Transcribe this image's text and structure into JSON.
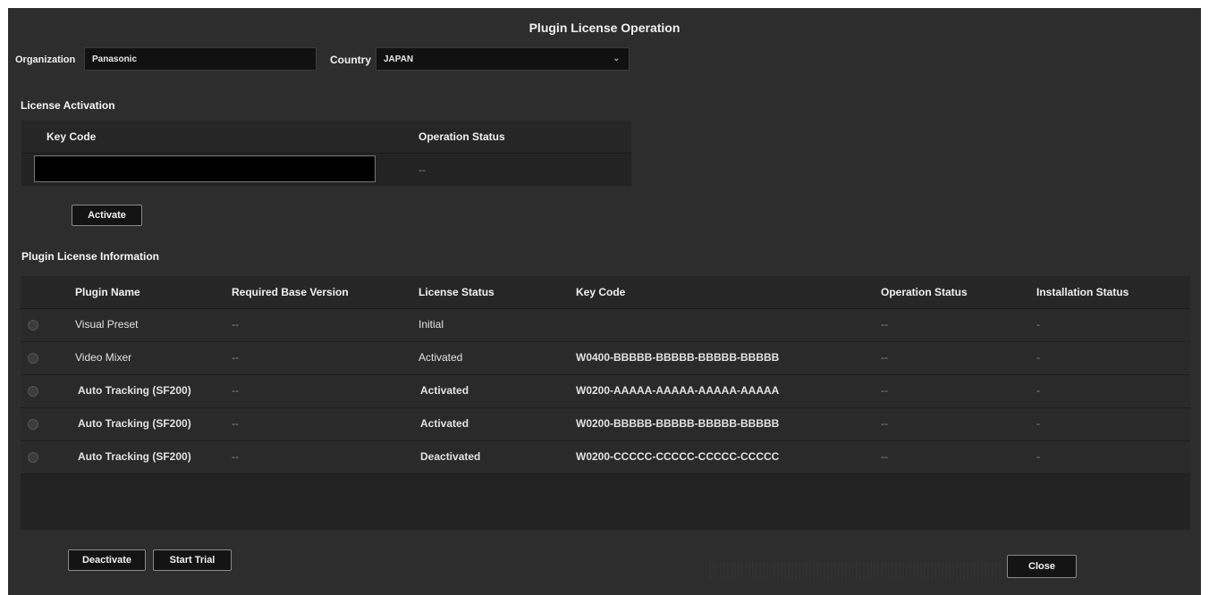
{
  "window": {
    "title": "Plugin License Operation"
  },
  "organization": {
    "label": "Organization",
    "value": "Panasonic"
  },
  "country": {
    "label": "Country",
    "value": "JAPAN"
  },
  "activation": {
    "section_title": "License Activation",
    "col_key_code": "Key Code",
    "col_operation_status": "Operation Status",
    "key_value": "",
    "operation_status": "--",
    "activate_label": "Activate"
  },
  "info": {
    "section_title": "Plugin License Information",
    "columns": {
      "plugin_name": "Plugin Name",
      "required_base_version": "Required Base Version",
      "license_status": "License Status",
      "key_code": "Key Code",
      "operation_status": "Operation Status",
      "installation_status": "Installation Status"
    },
    "rows": [
      {
        "plugin_name": "Visual Preset",
        "base_version": "--",
        "license_status": "Initial",
        "key_code": "",
        "operation_status": "--",
        "installation_status": "-"
      },
      {
        "plugin_name": "Video Mixer",
        "base_version": "--",
        "license_status": "Activated",
        "key_code": "W0400-BBBBB-BBBBB-BBBBB-BBBBB",
        "operation_status": "--",
        "installation_status": "-"
      },
      {
        "plugin_name": "Auto Tracking (SF200)",
        "base_version": "--",
        "license_status": "Activated",
        "key_code": "W0200-AAAAA-AAAAA-AAAAA-AAAAA",
        "operation_status": "--",
        "installation_status": "-"
      },
      {
        "plugin_name": "Auto Tracking (SF200)",
        "base_version": "--",
        "license_status": "Activated",
        "key_code": "W0200-BBBBB-BBBBB-BBBBB-BBBBB",
        "operation_status": "--",
        "installation_status": "-"
      },
      {
        "plugin_name": "Auto Tracking (SF200)",
        "base_version": "--",
        "license_status": "Deactivated",
        "key_code": "W0200-CCCCC-CCCCC-CCCCC-CCCCC",
        "operation_status": "--",
        "installation_status": "-"
      }
    ]
  },
  "buttons": {
    "deactivate": "Deactivate",
    "start_trial": "Start Trial",
    "close": "Close"
  },
  "icons": {
    "country_dropdown": "chevron-down-icon",
    "row_select": "radio-icon"
  },
  "colors": {
    "background": "#2d2d2d",
    "table": "#232323",
    "input": "#111111"
  }
}
